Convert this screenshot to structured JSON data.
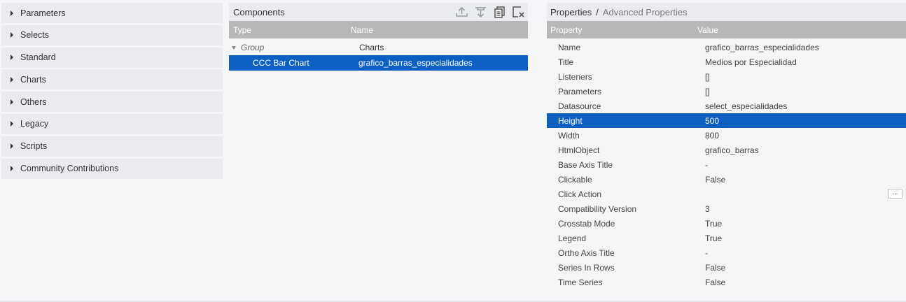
{
  "palette": {
    "items": [
      {
        "label": "Parameters"
      },
      {
        "label": "Selects"
      },
      {
        "label": "Standard"
      },
      {
        "label": "Charts"
      },
      {
        "label": "Others"
      },
      {
        "label": "Legacy"
      },
      {
        "label": "Scripts"
      },
      {
        "label": "Community Contributions"
      }
    ]
  },
  "components": {
    "title": "Components",
    "toolbar": [
      "move-up-icon",
      "move-down-icon",
      "duplicate-icon",
      "delete-icon"
    ],
    "columns": {
      "type": "Type",
      "name": "Name"
    },
    "rows": [
      {
        "type": "Group",
        "name": "Charts"
      },
      {
        "type": "CCC Bar Chart",
        "name": "grafico_barras_especialidades",
        "selected": true
      }
    ]
  },
  "properties": {
    "breadcrumb": {
      "first": "Properties",
      "separator": "/",
      "second": "Advanced Properties"
    },
    "columns": {
      "property": "Property",
      "value": "Value"
    },
    "rows": [
      {
        "name": "Name",
        "value": "grafico_barras_especialidades"
      },
      {
        "name": "Title",
        "value": "Medios por Especialidad"
      },
      {
        "name": "Listeners",
        "value": "[]"
      },
      {
        "name": "Parameters",
        "value": "[]"
      },
      {
        "name": "Datasource",
        "value": "select_especialidades"
      },
      {
        "name": "Height",
        "value": "500",
        "selected": true
      },
      {
        "name": "Width",
        "value": "800"
      },
      {
        "name": "HtmlObject",
        "value": "grafico_barras"
      },
      {
        "name": "Base Axis Title",
        "value": "-"
      },
      {
        "name": "Clickable",
        "value": "False"
      },
      {
        "name": "Click Action",
        "value": "",
        "button": "..."
      },
      {
        "name": "Compatibility Version",
        "value": "3"
      },
      {
        "name": "Crosstab Mode",
        "value": "True"
      },
      {
        "name": "Legend",
        "value": "True"
      },
      {
        "name": "Ortho Axis Title",
        "value": "-"
      },
      {
        "name": "Series In Rows",
        "value": "False"
      },
      {
        "name": "Time Series",
        "value": "False"
      }
    ]
  },
  "colors": {
    "selection": "#0d5fc2",
    "header": "#b5b7b9",
    "panel": "#e9ebee"
  }
}
